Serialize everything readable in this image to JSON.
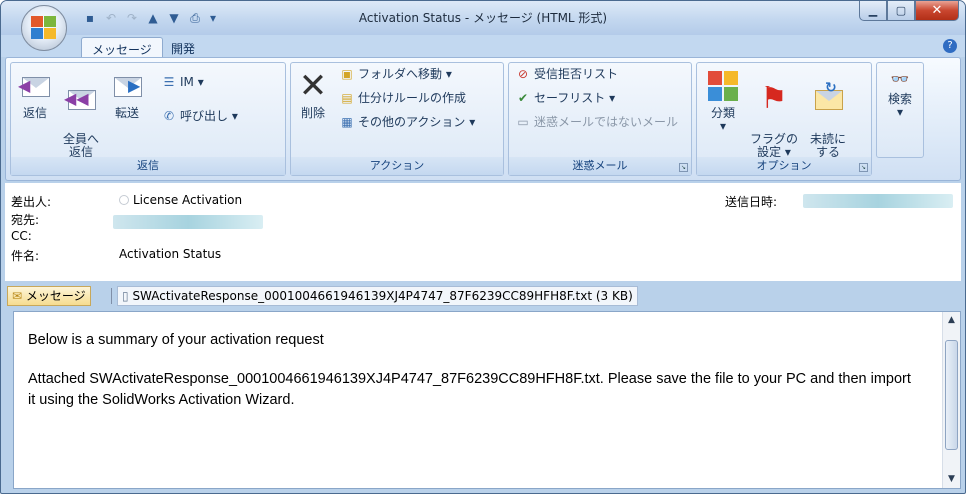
{
  "window": {
    "title": "Activation Status - メッセージ (HTML 形式)"
  },
  "tabs": [
    {
      "label": "メッセージ"
    },
    {
      "label": "開発"
    }
  ],
  "ribbon": {
    "groups": {
      "reply": {
        "label": "返信",
        "reply": "返信",
        "reply_all": "全員へ\n返信",
        "forward": "転送",
        "im": "IM ▾",
        "call": "呼び出し ▾"
      },
      "actions": {
        "label": "アクション",
        "delete": "削除",
        "move": "フォルダへ移動 ▾",
        "rules": "仕分けルールの作成",
        "other": "その他のアクション ▾"
      },
      "junk": {
        "label": "迷惑メール",
        "block": "受信拒否リスト",
        "safe": "セーフリスト ▾",
        "not_junk": "迷惑メールではないメール"
      },
      "options": {
        "label": "オプション",
        "categorize": "分類",
        "categorize_arrow": "▾",
        "follow_up": "フラグの\n設定 ▾",
        "unread": "未読に\nする"
      },
      "find": {
        "label": "検索",
        "arrow": "▾"
      }
    }
  },
  "header": {
    "from_label": "差出人:",
    "from_value": "License Activation",
    "to_label": "宛先:",
    "cc_label": "CC:",
    "subject_label": "件名:",
    "subject_value": "Activation Status",
    "sent_label": "送信日時:"
  },
  "attachments": {
    "message_tab": "メッセージ",
    "file": "SWActivateResponse_0001004661946139XJ4P4747_87F6239CC89HFH8F.txt (3 KB)"
  },
  "body": {
    "para1": "Below is a summary of your activation request",
    "para2": "Attached SWActivateResponse_0001004661946139XJ4P4747_87F6239CC89HFH8F.txt.  Please save the file to your PC and then import it using the SolidWorks Activation Wizard."
  }
}
